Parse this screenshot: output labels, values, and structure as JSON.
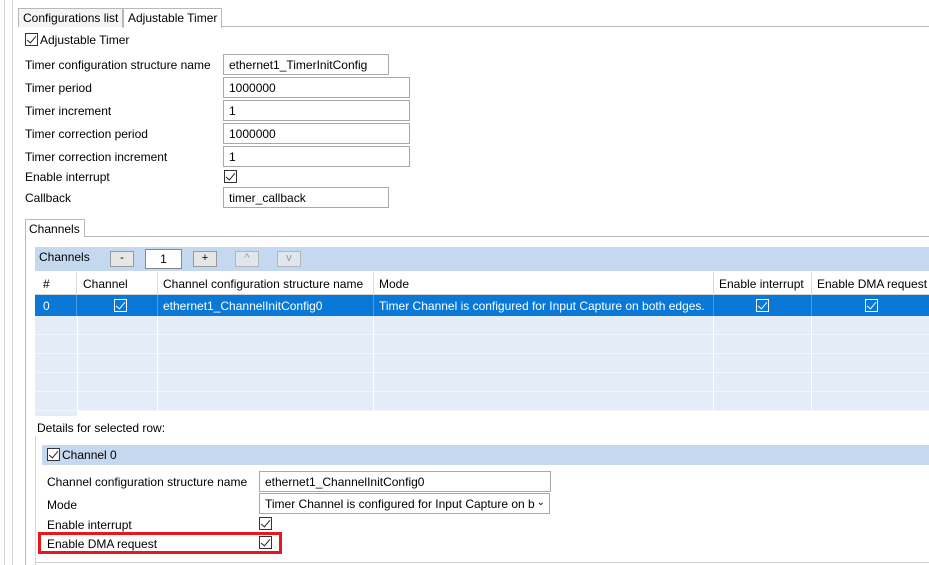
{
  "tabs": [
    {
      "label": "Configurations list",
      "active": false
    },
    {
      "label": "Adjustable Timer",
      "active": true
    }
  ],
  "timer": {
    "enable_label": "Adjustable Timer",
    "enabled": true,
    "fields": [
      {
        "label": "Timer configuration structure name",
        "value": "ethernet1_TimerInitConfig"
      },
      {
        "label": "Timer period",
        "value": "1000000"
      },
      {
        "label": "Timer increment",
        "value": "1"
      },
      {
        "label": "Timer correction period",
        "value": "1000000"
      },
      {
        "label": "Timer correction increment",
        "value": "1"
      }
    ],
    "enable_interrupt_label": "Enable interrupt",
    "enable_interrupt": true,
    "callback_label": "Callback",
    "callback_value": "timer_callback"
  },
  "channels": {
    "group_tab": "Channels",
    "toolbar_label": "Channels",
    "remove_btn": "-",
    "count": "1",
    "add_btn": "+",
    "up_btn": "^",
    "down_btn": "v",
    "columns": [
      "#",
      "Channel",
      "Channel configuration structure name",
      "Mode",
      "Enable interrupt",
      "Enable DMA request"
    ],
    "rows": [
      {
        "index": "0",
        "channel": true,
        "struct_name": "ethernet1_ChannelInitConfig0",
        "mode": "Timer Channel is configured for Input Capture on both edges.",
        "enable_interrupt": true,
        "enable_dma": true
      }
    ]
  },
  "details": {
    "title": "Details for selected row:",
    "channel_label": "Channel 0",
    "channel_enabled": true,
    "struct_label": "Channel configuration structure name",
    "struct_value": "ethernet1_ChannelInitConfig0",
    "mode_label": "Mode",
    "mode_value": "Timer Channel is configured for Input Capture on b",
    "enable_interrupt_label": "Enable interrupt",
    "enable_interrupt": true,
    "enable_dma_label": "Enable DMA request",
    "enable_dma": true
  },
  "colors": {
    "selection": "#0a78d7",
    "header_band": "#c4d8ef",
    "highlight_box": "#e8161d"
  }
}
